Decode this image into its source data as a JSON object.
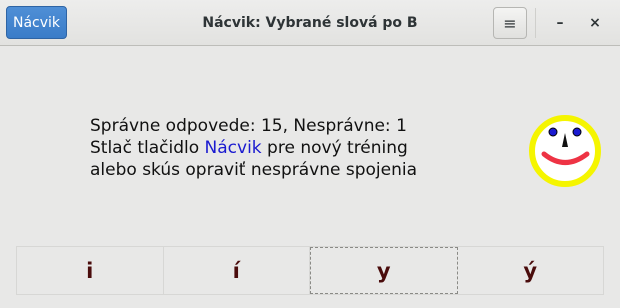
{
  "header": {
    "primary_button_label": "Nácvik",
    "title": "Nácvik: Vybrané slová po B",
    "menu_glyph": "≡",
    "minimize_glyph": "–",
    "close_glyph": "×"
  },
  "message": {
    "line1": "Správne odpovede: 15, Nesprávne: 1",
    "line2_before": "Stlač tlačidlo ",
    "line2_link": "Nácvik",
    "line2_after": " pre nový tréning",
    "line3": "alebo skús opraviť nesprávne spojenia"
  },
  "smiley": {
    "icon": "smiley-face-icon",
    "ring_color": "#f5f500",
    "eye_color": "#1a1ad0",
    "mouth_color": "#ee3344"
  },
  "letters": [
    {
      "label": "i"
    },
    {
      "label": "í"
    },
    {
      "label": "y"
    },
    {
      "label": "ý"
    }
  ],
  "colors": {
    "accent": "#3a7cc8",
    "link": "#1a1ad0",
    "letter": "#4a0c0c"
  }
}
